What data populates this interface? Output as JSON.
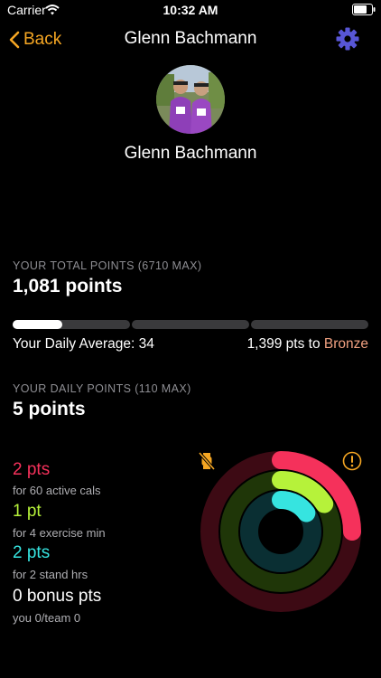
{
  "status_bar": {
    "carrier": "Carrier",
    "time": "10:32 AM"
  },
  "nav": {
    "back_label": "Back",
    "title": "Glenn Bachmann"
  },
  "profile": {
    "name": "Glenn Bachmann"
  },
  "total_points": {
    "label": "YOUR TOTAL POINTS (6710 MAX)",
    "value": "1,081 points",
    "progress_fraction_of_first_tier": 0.42,
    "tier_count": 3,
    "daily_average": "Your Daily Average: 34",
    "to_next_prefix": "1,399 pts to ",
    "next_tier": "Bronze"
  },
  "daily_points": {
    "label": "YOUR DAILY POINTS (110 MAX)",
    "value": "5 points"
  },
  "activity": {
    "move": {
      "points": "2 pts",
      "detail": "for 60 active cals",
      "ring_fraction": 0.25
    },
    "exercise": {
      "points": "1 pt",
      "detail": "for 4 exercise min",
      "ring_fraction": 0.16
    },
    "stand": {
      "points": "2 pts",
      "detail": "for 2 stand hrs",
      "ring_fraction": 0.15
    },
    "bonus": {
      "points": "0 bonus pts",
      "detail": "you 0/team 0"
    }
  },
  "colors": {
    "accent": "#f5a623",
    "gear": "#5856d6",
    "move": "#f5315b",
    "exercise": "#b6f23a",
    "stand": "#36e4e0",
    "tier": "#f0a080"
  },
  "icons": [
    "wifi-icon",
    "battery-icon",
    "chevron-left-icon",
    "gear-icon",
    "no-watch-icon",
    "alert-icon"
  ]
}
